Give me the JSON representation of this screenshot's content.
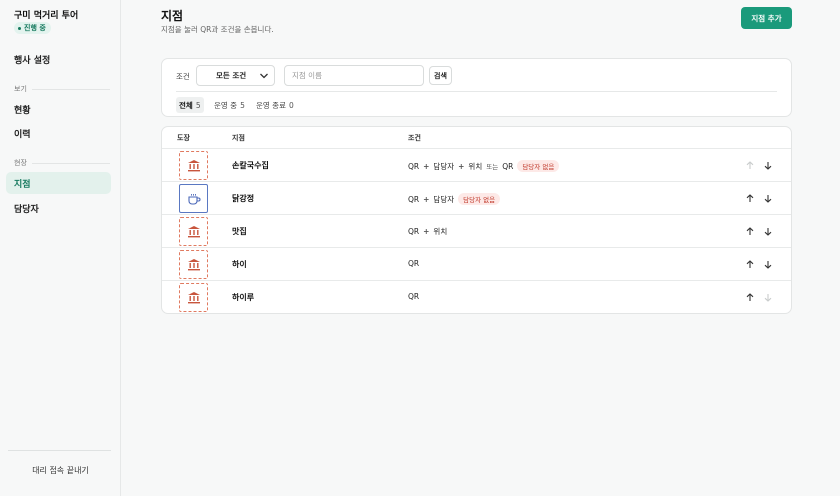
{
  "sidebar": {
    "event_title": "구미 먹거리 투어",
    "status_badge": "진행 중",
    "settings_label": "행사 설정",
    "view_section": "보기",
    "view_items": [
      "현황",
      "이력"
    ],
    "field_section": "현장",
    "field_items": [
      "지점",
      "담당자"
    ],
    "active_item": "지점",
    "proxy_exit": "대리 접속 끝내기"
  },
  "header": {
    "title": "지점",
    "subtitle": "지점을 눌러 QR과 조건을 손봅니다.",
    "add_button": "지점 추가"
  },
  "filter": {
    "condition_label": "조건",
    "condition_value": "모든 조건",
    "name_placeholder": "지점 이름",
    "search_button": "검색",
    "tabs": [
      {
        "label": "전체",
        "count": "5",
        "active": true
      },
      {
        "label": "운영 중",
        "count": "5",
        "active": false
      },
      {
        "label": "운영 종료",
        "count": "0",
        "active": false
      }
    ]
  },
  "table": {
    "headers": {
      "stamp": "도장",
      "name": "지점",
      "condition": "조건"
    },
    "rows": [
      {
        "icon": "bank-icon",
        "name": "손칼국수집",
        "conditions": [
          "QR",
          "담당자",
          "위치"
        ],
        "alt": "QR",
        "alt_connector": "또는",
        "badge": "담당자 없음"
      },
      {
        "icon": "coffee-icon",
        "name": "닭강정",
        "conditions": [
          "QR",
          "담당자"
        ],
        "badge": "담당자 없음"
      },
      {
        "icon": "bank-icon",
        "name": "맛집",
        "conditions": [
          "QR",
          "위치"
        ]
      },
      {
        "icon": "bank-icon",
        "name": "하이",
        "conditions": [
          "QR"
        ]
      },
      {
        "icon": "bank-icon",
        "name": "하이루",
        "conditions": [
          "QR"
        ]
      }
    ]
  },
  "colors": {
    "accent": "#1a9a7b",
    "stamp_dashed": "#e07a60",
    "stamp_solid": "#5a78c2",
    "warn_bg": "#fde9e7",
    "warn_fg": "#c0392b",
    "disabled_arrow": "#c9cccc"
  }
}
